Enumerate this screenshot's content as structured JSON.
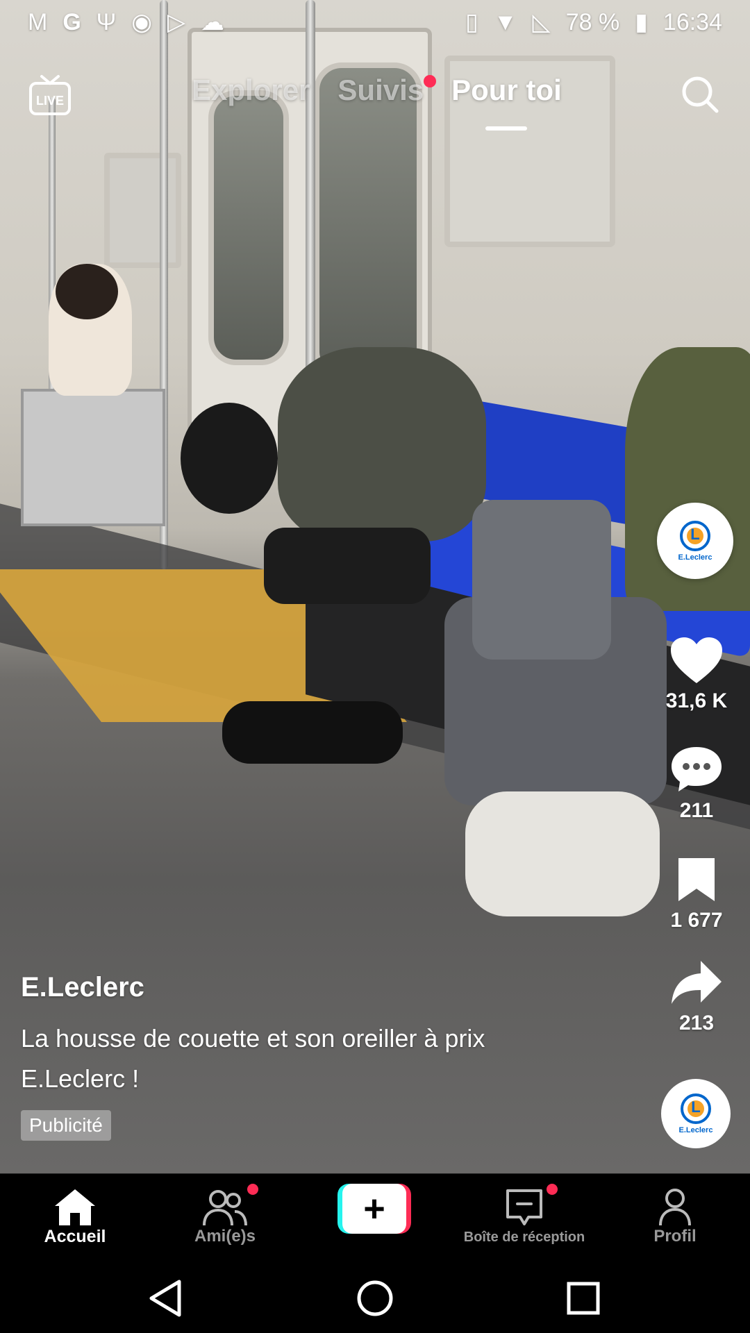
{
  "status_bar": {
    "left_icons": [
      "gmail-icon",
      "google-icon",
      "usb-icon",
      "wp-icon",
      "play-store-icon",
      "cloud-icon"
    ],
    "battery_percent": "78 %",
    "time": "16:34"
  },
  "top_nav": {
    "live_label": "LIVE",
    "tabs": [
      {
        "label": "Explorer",
        "active": false
      },
      {
        "label": "Suivis",
        "active": false,
        "has_dot": true
      },
      {
        "label": "Pour toi",
        "active": true
      }
    ]
  },
  "rail": {
    "account_logo_text": "E.Leclerc",
    "likes": "31,6 K",
    "comments": "211",
    "saves": "1 677",
    "shares": "213"
  },
  "caption": {
    "author": "E.Leclerc",
    "description": "La housse de couette et son oreiller à prix E.Leclerc !",
    "ad_badge": "Publicité",
    "music_logo_text": "E.Leclerc"
  },
  "tab_bar": {
    "items": [
      {
        "label": "Accueil",
        "icon": "home-icon",
        "active": true
      },
      {
        "label": "Ami(e)s",
        "icon": "friends-icon",
        "active": false,
        "has_dot": true
      },
      {
        "label": "",
        "icon": "plus-icon",
        "active": false
      },
      {
        "label": "Boîte de réception",
        "icon": "inbox-icon",
        "active": false,
        "has_dot": true
      },
      {
        "label": "Profil",
        "icon": "profile-icon",
        "active": false
      }
    ]
  },
  "colors": {
    "accent": "#fe2c55",
    "cyan": "#25f4ee",
    "leclerc_blue": "#0066cc",
    "leclerc_orange": "#f39200"
  }
}
